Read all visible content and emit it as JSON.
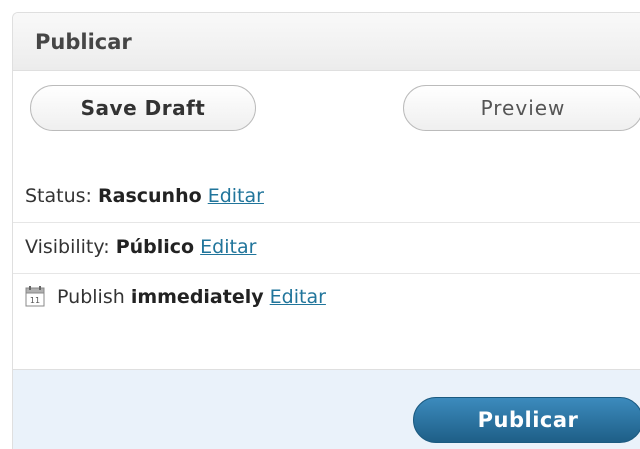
{
  "panel": {
    "title": "Publicar"
  },
  "buttons": {
    "save_draft": "Save Draft",
    "preview": "Preview",
    "publish": "Publicar"
  },
  "status": {
    "label": "Status:",
    "value": "Rascunho",
    "edit": "Editar"
  },
  "visibility": {
    "label": "Visibility:",
    "value": "Público",
    "edit": "Editar"
  },
  "publish_time": {
    "icon": "calendar-icon",
    "calendar_day": "11",
    "label": "Publish",
    "value": "immediately",
    "edit": "Editar"
  },
  "colors": {
    "link": "#21759b",
    "primary_button": "#21759b",
    "footer_bg": "#eaf2fa"
  }
}
